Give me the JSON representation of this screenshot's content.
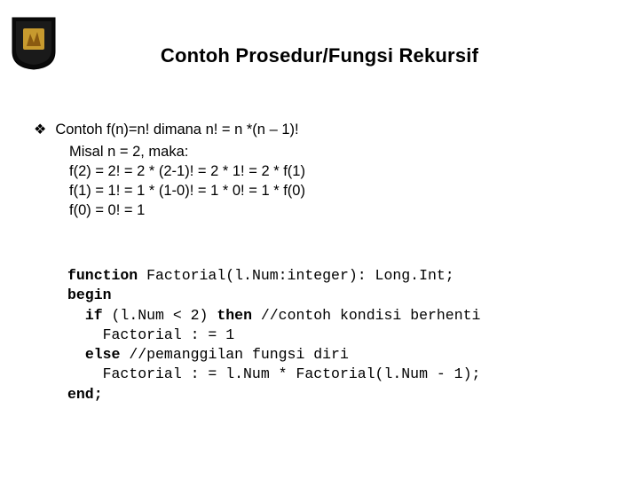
{
  "title": "Contoh Prosedur/Fungsi Rekursif",
  "bullet": {
    "glyph": "❖",
    "lead": "Contoh f(n)=n! dimana n! = n *(n – 1)!"
  },
  "explain": {
    "l1": "Misal n = 2, maka:",
    "l2": "f(2) = 2! = 2 * (2-1)! = 2 * 1! = 2 * f(1)",
    "l3": "f(1) = 1! = 1 * (1-0)! = 1 * 0! = 1 * f(0)",
    "l4": "f(0) = 0! = 1"
  },
  "code": {
    "kw_function": "function",
    "sig_rest": " Factorial(l.Num:integer): Long.Int;",
    "kw_begin": "begin",
    "indent1": "  ",
    "kw_if": "if",
    "if_cond": " (l.Num < 2) ",
    "kw_then": "then",
    "if_comment": " //contoh kondisi berhenti",
    "indent2": "    ",
    "assign1": "Factorial : = 1",
    "kw_else": "else",
    "else_comment": " //pemanggilan fungsi diri",
    "assign2": "Factorial : = l.Num * Factorial(l.Num - 1);",
    "kw_end": "end;"
  }
}
